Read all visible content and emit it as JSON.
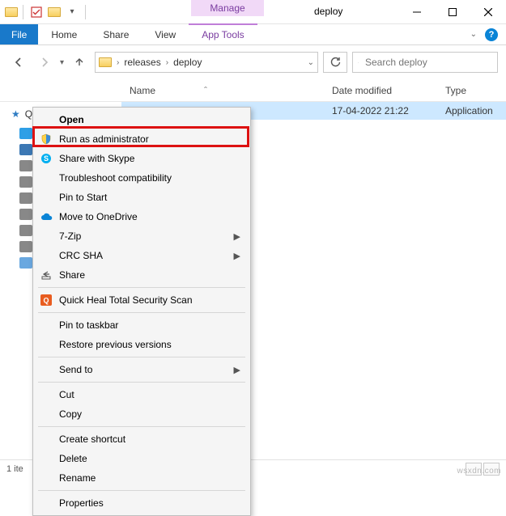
{
  "window": {
    "title": "deploy",
    "manage_label": "Manage"
  },
  "ribbon": {
    "file": "File",
    "home": "Home",
    "share": "Share",
    "view": "View",
    "apptools": "App Tools"
  },
  "address": {
    "seg1": "releases",
    "seg2": "deploy"
  },
  "search": {
    "placeholder": "Search deploy"
  },
  "columns": {
    "name": "Name",
    "date": "Date modified",
    "type": "Type"
  },
  "sidebar": {
    "quick_access": "Quick access"
  },
  "file_row": {
    "name": "",
    "date": "17-04-2022 21:22",
    "type": "Application"
  },
  "ctx": {
    "open": "Open",
    "run_admin": "Run as administrator",
    "skype": "Share with Skype",
    "troubleshoot": "Troubleshoot compatibility",
    "pin_start": "Pin to Start",
    "onedrive": "Move to OneDrive",
    "sevenzip": "7-Zip",
    "crc": "CRC SHA",
    "share": "Share",
    "quickheal": "Quick Heal Total Security Scan",
    "pin_taskbar": "Pin to taskbar",
    "restore": "Restore previous versions",
    "sendto": "Send to",
    "cut": "Cut",
    "copy": "Copy",
    "shortcut": "Create shortcut",
    "delete": "Delete",
    "rename": "Rename",
    "properties": "Properties"
  },
  "status": {
    "text": "1 ite"
  },
  "watermark": "wsxdn.com"
}
